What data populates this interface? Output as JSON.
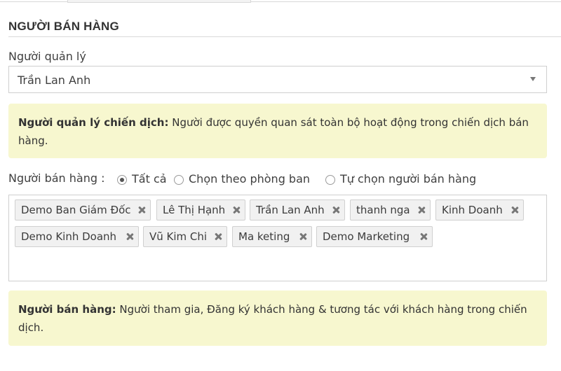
{
  "section": {
    "title": "NGƯỜI BÁN HÀNG"
  },
  "manager": {
    "label": "Người quản lý",
    "selected_value": "Trần Lan Anh",
    "note_strong": "Người quản lý chiến dịch:",
    "note_text": " Người được quyền quan sát toàn bộ hoạt động trong chiến dịch bán hàng."
  },
  "sales": {
    "label": "Người bán hàng :",
    "radios": [
      {
        "label": "Tất cả",
        "checked": true
      },
      {
        "label": "Chọn theo phòng ban",
        "checked": false
      },
      {
        "label": "Tự chọn người bán hàng",
        "checked": false
      }
    ],
    "tags": [
      "Demo Ban Giám Đốc",
      "Lê Thị Hạnh",
      "Trần Lan Anh",
      "thanh nga",
      "Kinh Doanh",
      "Demo Kinh Doanh",
      "Vũ Kim Chi",
      "Ma keting",
      "Demo Marketing"
    ],
    "note_strong": "Người bán hàng:",
    "note_text": " Người tham gia, Đăng ký khách hàng & tương tác với khách hàng trong chiến dịch."
  },
  "icons": {
    "dropdown": "chevron-down-icon",
    "tag_remove": "close-icon"
  },
  "colors": {
    "note_background": "#f7f7cf",
    "tag_background": "#f1f1f1",
    "border": "#cfcfcf"
  }
}
